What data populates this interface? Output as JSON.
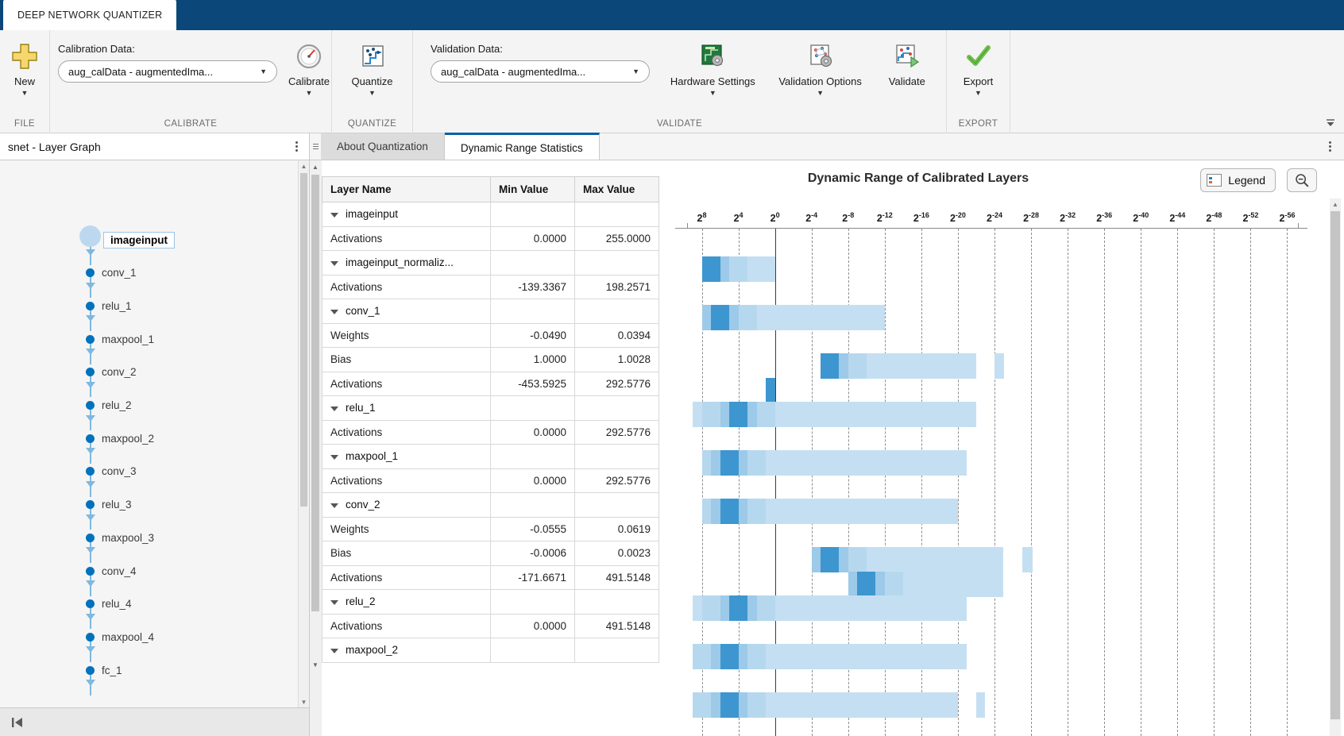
{
  "titlebar": {
    "app_tab": "DEEP NETWORK QUANTIZER"
  },
  "ribbon": {
    "groups": [
      {
        "label": "FILE"
      },
      {
        "label": "CALIBRATE"
      },
      {
        "label": "QUANTIZE"
      },
      {
        "label": "VALIDATE"
      },
      {
        "label": "EXPORT"
      }
    ],
    "new_button": "New",
    "calibration_label": "Calibration Data:",
    "calibration_value": "aug_calData - augmentedIma...",
    "calibrate_button": "Calibrate",
    "quantize_button": "Quantize",
    "validation_label": "Validation Data:",
    "validation_value": "aug_calData - augmentedIma...",
    "hardware_settings_button": "Hardware Settings",
    "validation_options_button": "Validation Options",
    "validate_button": "Validate",
    "export_button": "Export"
  },
  "left_panel": {
    "title": "snet - Layer Graph",
    "nodes": [
      {
        "name": "imageinput",
        "selected": true
      },
      {
        "name": "conv_1",
        "selected": false
      },
      {
        "name": "relu_1",
        "selected": false
      },
      {
        "name": "maxpool_1",
        "selected": false
      },
      {
        "name": "conv_2",
        "selected": false
      },
      {
        "name": "relu_2",
        "selected": false
      },
      {
        "name": "maxpool_2",
        "selected": false
      },
      {
        "name": "conv_3",
        "selected": false
      },
      {
        "name": "relu_3",
        "selected": false
      },
      {
        "name": "maxpool_3",
        "selected": false
      },
      {
        "name": "conv_4",
        "selected": false
      },
      {
        "name": "relu_4",
        "selected": false
      },
      {
        "name": "maxpool_4",
        "selected": false
      },
      {
        "name": "fc_1",
        "selected": false
      }
    ]
  },
  "tabs": [
    {
      "label": "About Quantization",
      "active": false
    },
    {
      "label": "Dynamic Range Statistics",
      "active": true
    }
  ],
  "table": {
    "columns": [
      "Layer Name",
      "Min Value",
      "Max Value"
    ],
    "rows": [
      {
        "type": "group",
        "name": "imageinput",
        "min": "",
        "max": ""
      },
      {
        "type": "sub",
        "name": "Activations",
        "min": "0.0000",
        "max": "255.0000"
      },
      {
        "type": "group",
        "name": "imageinput_normaliz...",
        "min": "",
        "max": ""
      },
      {
        "type": "sub",
        "name": "Activations",
        "min": "-139.3367",
        "max": "198.2571"
      },
      {
        "type": "group",
        "name": "conv_1",
        "min": "",
        "max": ""
      },
      {
        "type": "sub",
        "name": "Weights",
        "min": "-0.0490",
        "max": "0.0394"
      },
      {
        "type": "sub",
        "name": "Bias",
        "min": "1.0000",
        "max": "1.0028"
      },
      {
        "type": "sub",
        "name": "Activations",
        "min": "-453.5925",
        "max": "292.5776"
      },
      {
        "type": "group",
        "name": "relu_1",
        "min": "",
        "max": ""
      },
      {
        "type": "sub",
        "name": "Activations",
        "min": "0.0000",
        "max": "292.5776"
      },
      {
        "type": "group",
        "name": "maxpool_1",
        "min": "",
        "max": ""
      },
      {
        "type": "sub",
        "name": "Activations",
        "min": "0.0000",
        "max": "292.5776"
      },
      {
        "type": "group",
        "name": "conv_2",
        "min": "",
        "max": ""
      },
      {
        "type": "sub",
        "name": "Weights",
        "min": "-0.0555",
        "max": "0.0619"
      },
      {
        "type": "sub",
        "name": "Bias",
        "min": "-0.0006",
        "max": "0.0023"
      },
      {
        "type": "sub",
        "name": "Activations",
        "min": "-171.6671",
        "max": "491.5148"
      },
      {
        "type": "group",
        "name": "relu_2",
        "min": "",
        "max": ""
      },
      {
        "type": "sub",
        "name": "Activations",
        "min": "0.0000",
        "max": "491.5148"
      },
      {
        "type": "group",
        "name": "maxpool_2",
        "min": "",
        "max": ""
      }
    ]
  },
  "chart_data": {
    "type": "bar",
    "title": "Dynamic Range of Calibrated Layers",
    "xlabel": "",
    "ylabel": "",
    "legend_button": "Legend",
    "zoom_out_icon": "zoom-out-icon",
    "grid": true,
    "zero_line_exponent": 0,
    "tick_labels": [
      "2^8",
      "2^4",
      "2^0",
      "2^-4",
      "2^-8",
      "2^-12",
      "2^-16",
      "2^-20",
      "2^-24",
      "2^-28",
      "2^-32",
      "2^-36",
      "2^-40",
      "2^-44",
      "2^-48",
      "2^-52",
      "2^-56"
    ],
    "tick_exponents": [
      8,
      4,
      0,
      -4,
      -8,
      -12,
      -16,
      -20,
      -24,
      -28,
      -32,
      -36,
      -40,
      -44,
      -48,
      -52,
      -56
    ],
    "xaxis_range": [
      9,
      -57
    ],
    "series": [
      {
        "row": 1,
        "label": "imageinput / Activations",
        "start_exp": 8,
        "end_exp": 0,
        "peak_exp": 7
      },
      {
        "row": 3,
        "label": "imageinput_normalization / Activations",
        "start_exp": 8,
        "end_exp": -12,
        "peak_exp": 6
      },
      {
        "row": 5,
        "label": "conv_1 / Weights",
        "start_exp": -5,
        "end_exp": -22,
        "peak_exp": -6
      },
      {
        "row": 6,
        "label": "conv_1 / Bias",
        "start_exp": 1,
        "end_exp": 0,
        "peak_exp": 1
      },
      {
        "row": 7,
        "label": "conv_1 / Activations",
        "start_exp": 9,
        "end_exp": -22,
        "peak_exp": 4
      },
      {
        "row": 9,
        "label": "relu_1 / Activations",
        "start_exp": 8,
        "end_exp": -21,
        "peak_exp": 5
      },
      {
        "row": 11,
        "label": "maxpool_1 / Activations",
        "start_exp": 8,
        "end_exp": -20,
        "peak_exp": 5
      },
      {
        "row": 13,
        "label": "conv_2 / Weights",
        "start_exp": -4,
        "end_exp": -25,
        "peak_exp": -6
      },
      {
        "row": 14,
        "label": "conv_2 / Bias",
        "start_exp": -8,
        "end_exp": -25,
        "peak_exp": -10
      },
      {
        "row": 15,
        "label": "conv_2 / Activations",
        "start_exp": 9,
        "end_exp": -21,
        "peak_exp": 4
      },
      {
        "row": 17,
        "label": "relu_2 / Activations",
        "start_exp": 9,
        "end_exp": -21,
        "peak_exp": 5
      },
      {
        "row": 19,
        "label": "maxpool_2 / Activations",
        "start_exp": 9,
        "end_exp": -20,
        "peak_exp": 5
      }
    ],
    "colors": {
      "dark": "#0f7bc4",
      "mid": "#7fb6dd",
      "light": "#c5dff2"
    }
  }
}
